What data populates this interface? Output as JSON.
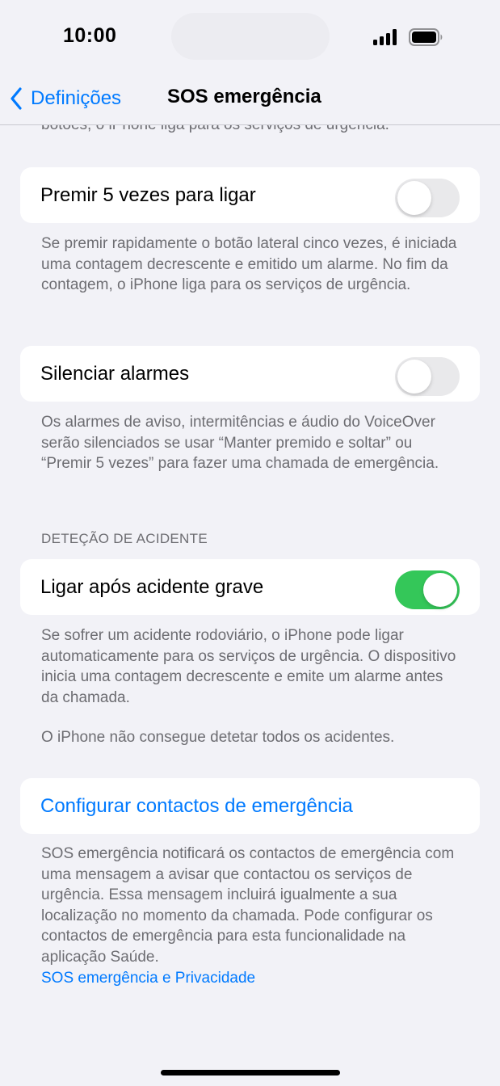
{
  "status": {
    "time": "10:00"
  },
  "nav": {
    "back_label": "Definições",
    "title": "SOS emergência"
  },
  "content": {
    "clipped_top_text": "botões, o iPhone liga para os serviços de urgência.",
    "row_press5": {
      "label": "Premir 5 vezes para ligar",
      "toggle_on": false
    },
    "press5_footnote": "Se premir rapidamente o botão lateral cinco vezes, é iniciada uma contagem decrescente e emitido um alarme. No fim da contagem, o iPhone liga para os serviços de urgência.",
    "row_silence": {
      "label": "Silenciar alarmes",
      "toggle_on": false
    },
    "silence_footnote": "Os alarmes de aviso, intermitências e áudio do VoiceOver serão silenciados se usar “Manter premido e soltar” ou “Premir 5 vezes” para fazer uma chamada de emergência.",
    "crash_section_header": "DETEÇÃO DE ACIDENTE",
    "row_crash": {
      "label": "Ligar após acidente grave",
      "toggle_on": true
    },
    "crash_footnote_1": "Se sofrer um acidente rodoviário, o iPhone pode ligar automaticamente para os serviços de urgência. O dispositivo inicia uma contagem decrescente e emite um alarme antes da chamada.",
    "crash_footnote_2": "O iPhone não consegue detetar todos os acidentes.",
    "setup_contacts_label": "Configurar contactos de emergência",
    "contacts_footnote": "SOS emergência notificará os contactos de emergência com uma mensagem a avisar que contactou os serviços de urgência. Essa mensagem incluirá igualmente a sua localização no momento da chamada. Pode configurar os contactos de emergência para esta funcionalidade na aplicação Saúde.",
    "privacy_link": "SOS emergência e Privacidade"
  },
  "colors": {
    "accent": "#007aff",
    "toggle_on": "#34c759",
    "toggle_off": "#e9e9eb",
    "background": "#f2f2f7"
  }
}
